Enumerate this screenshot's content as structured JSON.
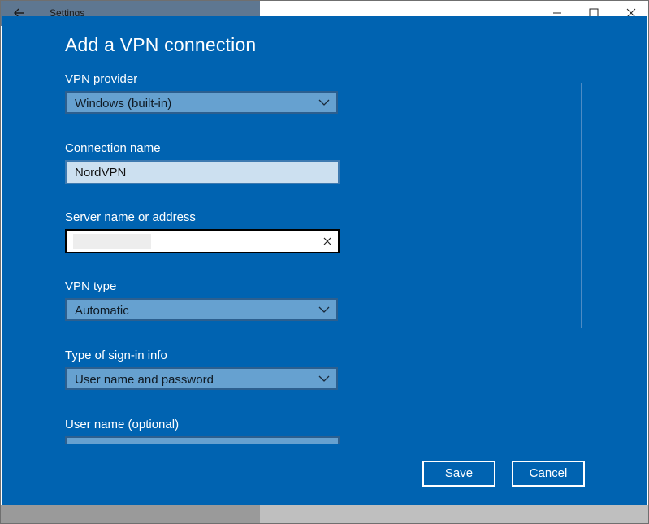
{
  "background_window": {
    "title": "Settings",
    "back_icon": "back-arrow-icon",
    "controls": [
      "minimize-icon",
      "maximize-icon",
      "close-icon"
    ]
  },
  "dialog": {
    "title": "Add a VPN connection",
    "vpn_provider": {
      "label": "VPN provider",
      "value": "Windows (built-in)"
    },
    "connection_name": {
      "label": "Connection name",
      "value": "NordVPN"
    },
    "server": {
      "label": "Server name or address",
      "value": ""
    },
    "vpn_type": {
      "label": "VPN type",
      "value": "Automatic"
    },
    "sign_in_type": {
      "label": "Type of sign-in info",
      "value": "User name and password"
    },
    "user_name": {
      "label": "User name (optional)"
    },
    "save_label": "Save",
    "cancel_label": "Cancel"
  },
  "colors": {
    "dialog_bg": "#0063b1",
    "select_bg": "#66a1d0",
    "text_light": "#ffffff"
  }
}
